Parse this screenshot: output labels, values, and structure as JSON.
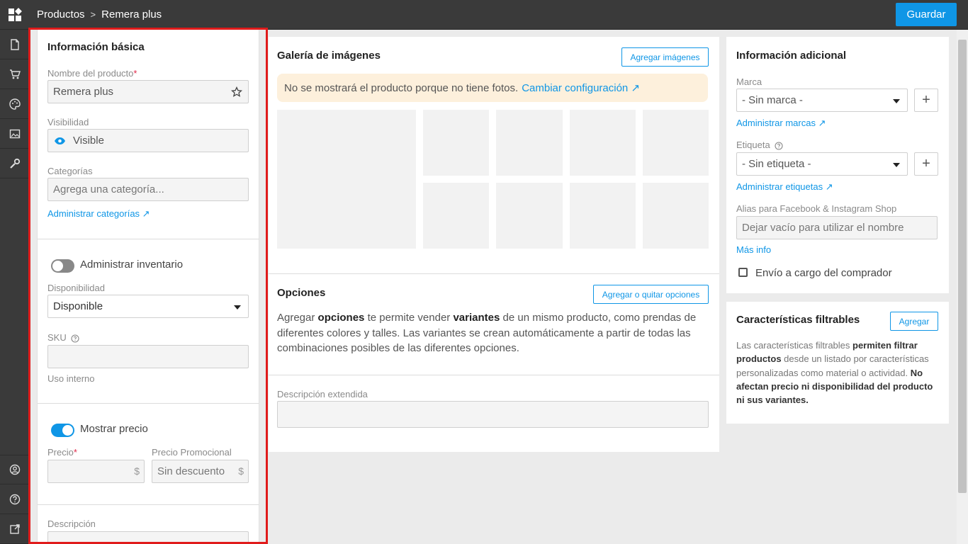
{
  "topbar": {
    "breadcrumb_root": "Productos",
    "breadcrumb_sep": ">",
    "breadcrumb_current": "Remera plus",
    "save_label": "Guardar"
  },
  "rail": {
    "items": [
      "document-icon",
      "cart-icon",
      "palette-icon",
      "image-icon",
      "tools-icon",
      "user-icon",
      "help-icon",
      "external-link-icon"
    ]
  },
  "basic": {
    "title": "Información básica",
    "name_label": "Nombre del producto",
    "required_mark": "*",
    "name_value": "Remera plus",
    "visibility_label": "Visibilidad",
    "visibility_value": "Visible",
    "categories_label": "Categorías",
    "categories_placeholder": "Agrega una categoría...",
    "manage_categories": "Administrar categorías ↗"
  },
  "inventory": {
    "toggle_label": "Administrar inventario",
    "toggle_on": false,
    "availability_label": "Disponibilidad",
    "availability_value": "Disponible",
    "sku_label": "SKU",
    "sku_value": "",
    "internal_use": "Uso interno"
  },
  "pricing": {
    "toggle_label": "Mostrar precio",
    "toggle_on": true,
    "price_label": "Precio",
    "price_value": "",
    "currency": "$",
    "promo_label": "Precio Promocional",
    "promo_placeholder": "Sin descuento"
  },
  "description": {
    "label": "Descripción"
  },
  "gallery": {
    "title": "Galería de imágenes",
    "add_button": "Agregar imágenes",
    "warning_text": "No se mostrará el producto porque no tiene fotos.",
    "warning_link": "Cambiar configuración ↗"
  },
  "options": {
    "title": "Opciones",
    "add_button": "Agregar o quitar opciones",
    "text_1": "Agregar ",
    "bold_1": "opciones",
    "text_2": " te permite vender ",
    "bold_2": "variantes",
    "text_3": " de un mismo producto, como prendas de diferentes colores y talles. Las variantes se crean automáticamente a partir de todas las combinaciones posibles de las diferentes opciones.",
    "extended_desc_label": "Descripción extendida"
  },
  "additional": {
    "title": "Información adicional",
    "brand_label": "Marca",
    "brand_value": "- Sin marca -",
    "manage_brands": "Administrar marcas ↗",
    "tag_label": "Etiqueta",
    "tag_value": "- Sin etiqueta -",
    "manage_tags": "Administrar etiquetas ↗",
    "alias_label": "Alias para Facebook & Instagram Shop",
    "alias_placeholder": "Dejar vacío para utilizar el nombre",
    "more_info": "Más info",
    "shipping_label": "Envío a cargo del comprador",
    "shipping_checked": false,
    "plus": "+"
  },
  "filters": {
    "title": "Características filtrables",
    "add_button": "Agregar",
    "t1": "Las características filtrables ",
    "b1": "permiten filtrar productos",
    "t2": " desde un listado por características personalizadas como material o actividad. ",
    "b2": "No afectan precio ni disponibilidad del producto ni sus variantes."
  },
  "colors": {
    "accent": "#0f96e6",
    "topbar": "#3a3a3a",
    "warning_bg": "#fdf0dc",
    "highlight": "#e01b1b",
    "required": "#e0294a"
  }
}
